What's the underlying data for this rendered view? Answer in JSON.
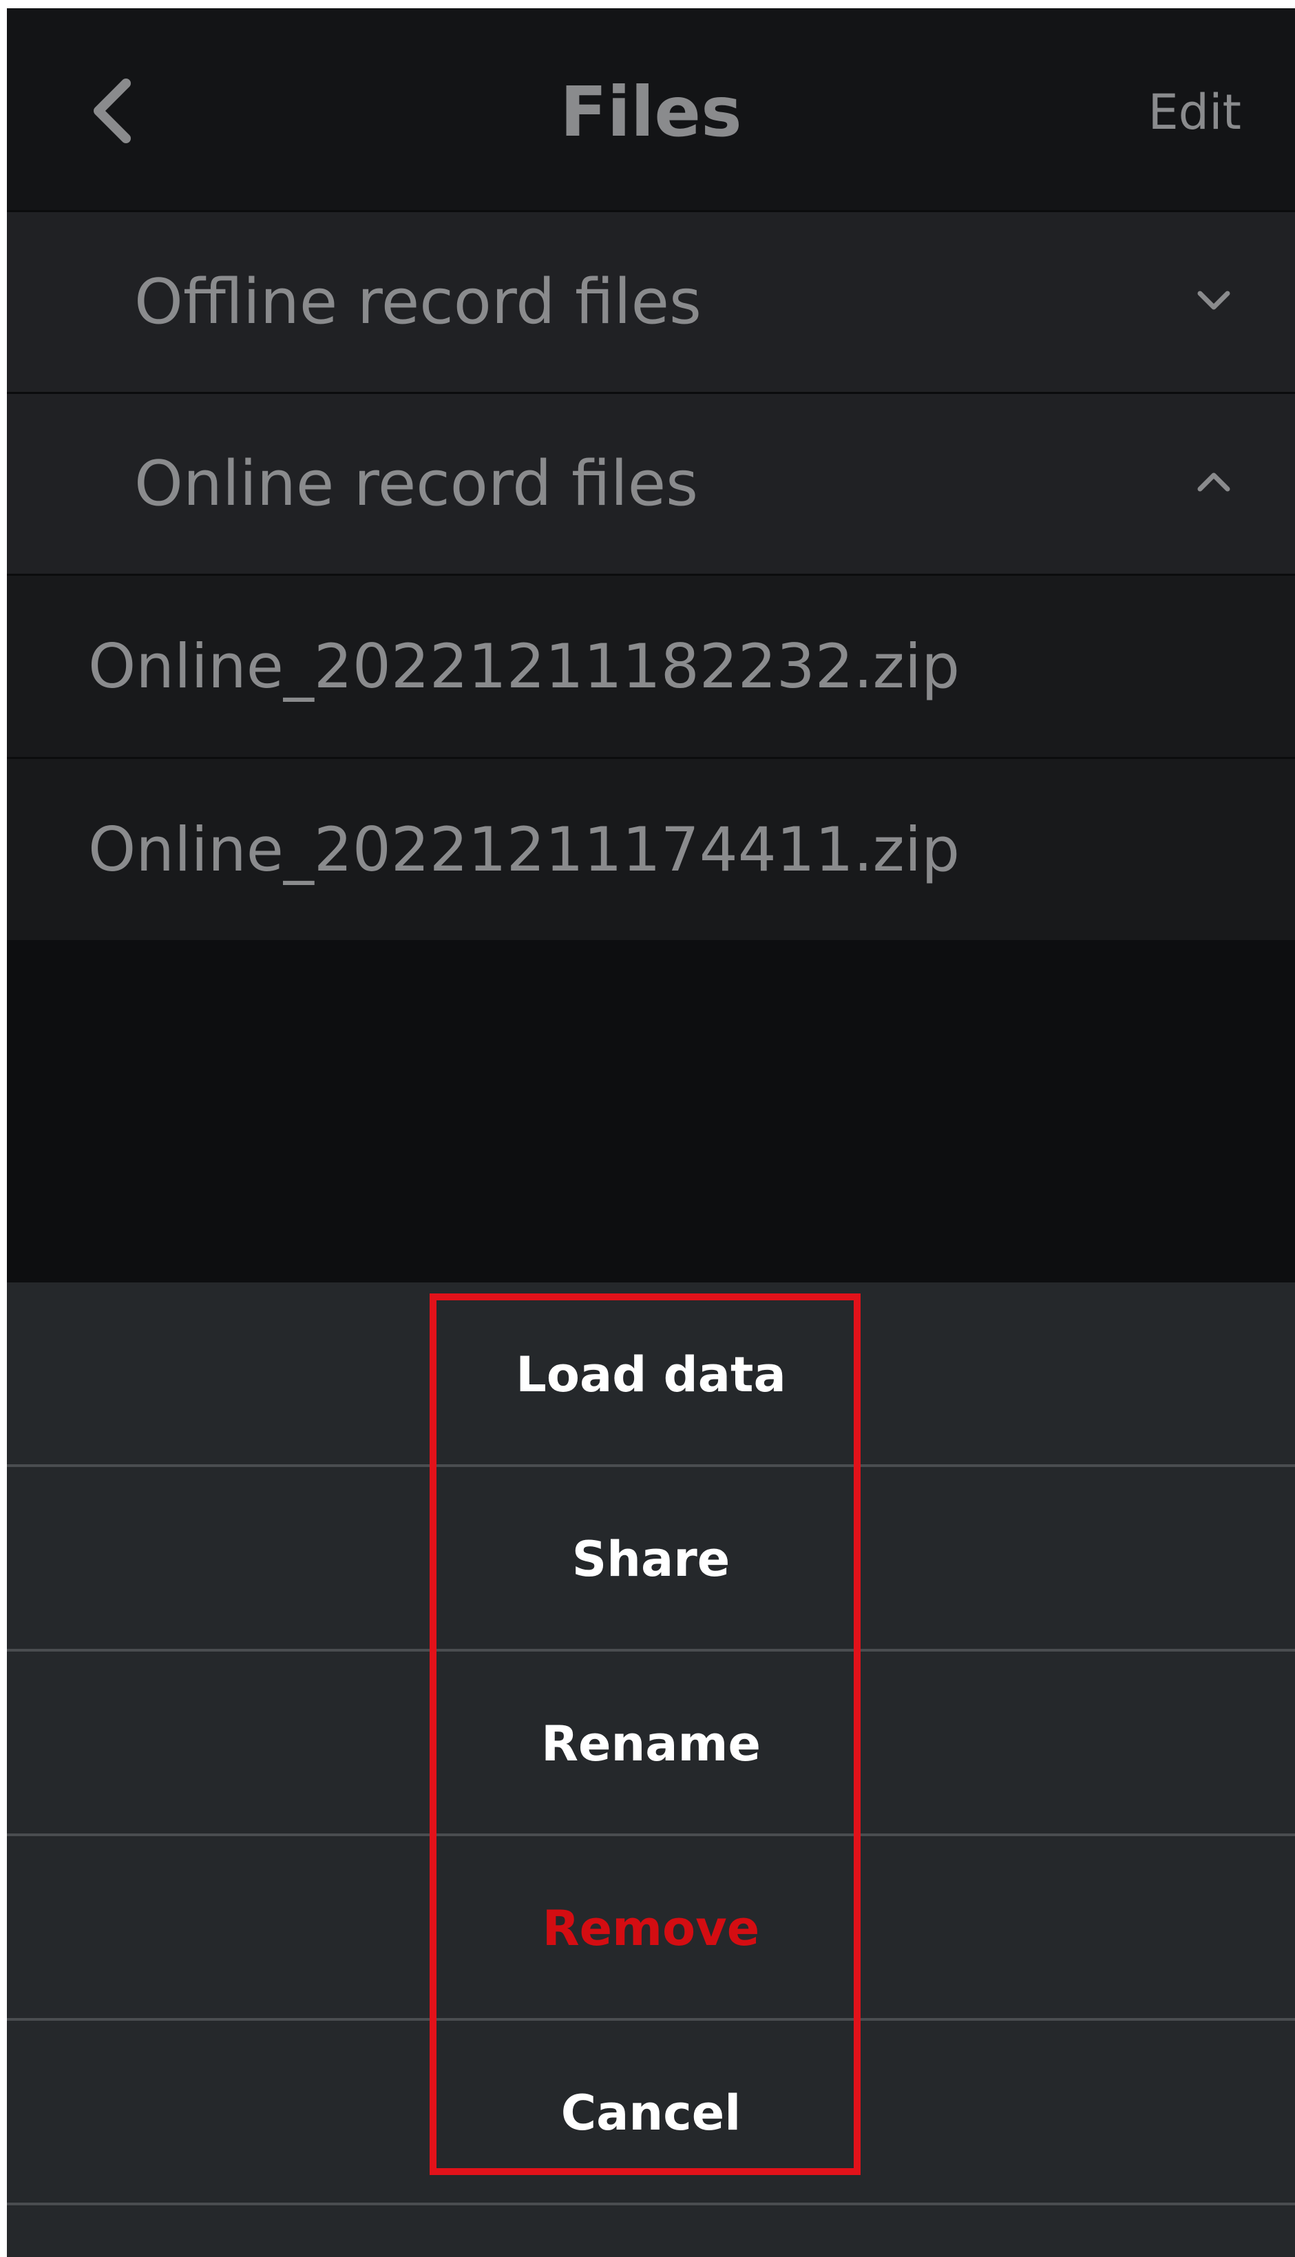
{
  "header": {
    "title": "Files",
    "edit_label": "Edit",
    "icons": {
      "back": "chevron-left-icon"
    }
  },
  "sections": [
    {
      "label": "Offline record files",
      "expanded": false,
      "icon": "chevron-down-icon"
    },
    {
      "label": "Online record files",
      "expanded": true,
      "icon": "chevron-up-icon"
    }
  ],
  "files": [
    "Online_20221211182232.zip",
    "Online_20221211174411.zip"
  ],
  "action_sheet": {
    "items": [
      {
        "label": "Load data",
        "style": "default"
      },
      {
        "label": "Share",
        "style": "default"
      },
      {
        "label": "Rename",
        "style": "default"
      },
      {
        "label": "Remove",
        "style": "destructive"
      },
      {
        "label": "Cancel",
        "style": "default"
      }
    ]
  },
  "colors": {
    "destructive": "#d40d12",
    "highlight": "#e2121a",
    "muted_text": "#8a8b8d"
  }
}
